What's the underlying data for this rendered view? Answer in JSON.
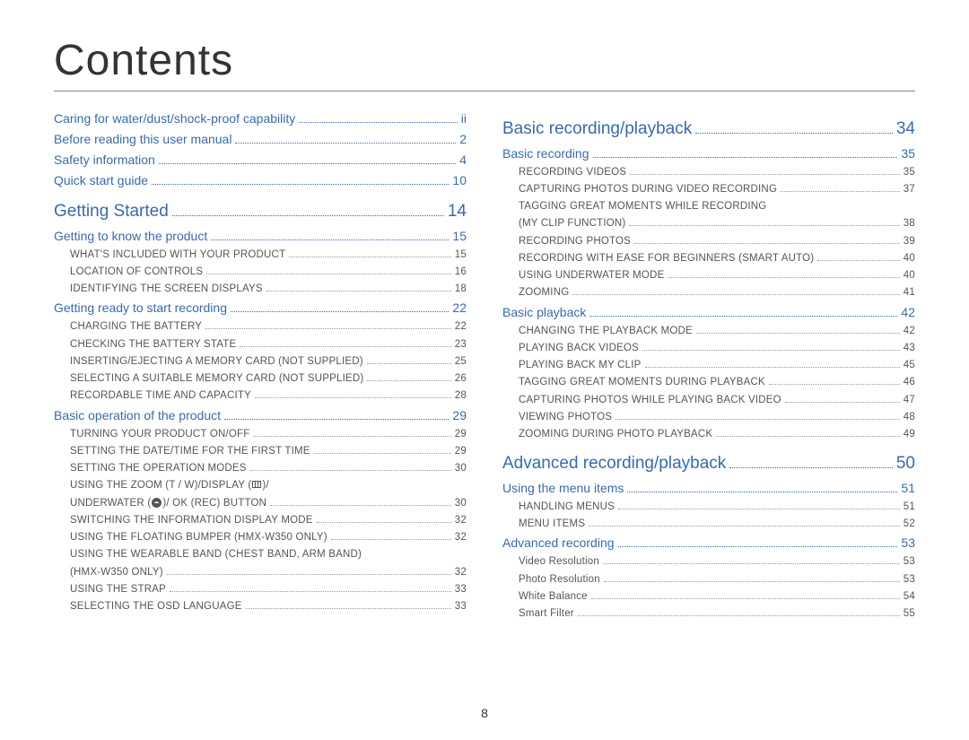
{
  "title": "Contents",
  "page_number": "8",
  "left": [
    {
      "level": "chapter",
      "label": "Caring for water/dust/shock-proof capability",
      "page": "ii"
    },
    {
      "level": "chapter",
      "label": "Before reading this user manual",
      "page": "2"
    },
    {
      "level": "chapter",
      "label": "Safety information",
      "page": "4"
    },
    {
      "level": "chapter",
      "label": "Quick start guide",
      "page": "10"
    },
    {
      "level": "section",
      "label": "Getting Started",
      "page": "14"
    },
    {
      "level": "chapter",
      "label": "Getting to know the product",
      "page": "15"
    },
    {
      "level": "sub",
      "label": "WHAT'S INCLUDED WITH YOUR PRODUCT",
      "page": "15"
    },
    {
      "level": "sub",
      "label": "LOCATION OF CONTROLS",
      "page": "16"
    },
    {
      "level": "sub",
      "label": "IDENTIFYING THE SCREEN DISPLAYS",
      "page": "18"
    },
    {
      "level": "chapter",
      "label": "Getting ready to start recording",
      "page": "22"
    },
    {
      "level": "sub",
      "label": "CHARGING THE BATTERY",
      "page": "22"
    },
    {
      "level": "sub",
      "label": "CHECKING THE BATTERY STATE",
      "page": "23"
    },
    {
      "level": "sub",
      "label": "INSERTING/EJECTING A MEMORY CARD (NOT SUPPLIED)",
      "page": "25"
    },
    {
      "level": "sub",
      "label": "SELECTING A SUITABLE MEMORY CARD (NOT SUPPLIED)",
      "page": "26"
    },
    {
      "level": "sub",
      "label": "RECORDABLE TIME AND CAPACITY",
      "page": "28"
    },
    {
      "level": "chapter",
      "label": "Basic operation of the product",
      "page": "29"
    },
    {
      "level": "sub",
      "label": "TURNING YOUR PRODUCT ON/OFF",
      "page": "29"
    },
    {
      "level": "sub",
      "label": "SETTING THE DATE/TIME FOR THE FIRST TIME",
      "page": "29"
    },
    {
      "level": "sub",
      "label": "SETTING THE OPERATION MODES",
      "page": "30"
    },
    {
      "level": "sub",
      "label": "USING THE ZOOM (T / W)/DISPLAY ([ICON_BOX])/",
      "page": "",
      "nopage": true
    },
    {
      "level": "sub",
      "label": "UNDERWATER ([ICON_UW])/ OK (REC) BUTTON",
      "page": "30"
    },
    {
      "level": "sub",
      "label": "SWITCHING THE INFORMATION DISPLAY MODE",
      "page": "32"
    },
    {
      "level": "sub",
      "label": "USING THE FLOATING BUMPER (HMX-W350 ONLY)",
      "page": "32"
    },
    {
      "level": "sub",
      "label": "USING THE WEARABLE BAND (CHEST BAND, ARM BAND)",
      "page": "",
      "nopage": true
    },
    {
      "level": "sub",
      "label": "(HMX-W350 ONLY)",
      "page": "32"
    },
    {
      "level": "sub",
      "label": "USING THE STRAP",
      "page": "33"
    },
    {
      "level": "sub",
      "label": "SELECTING THE OSD LANGUAGE",
      "page": "33"
    }
  ],
  "right": [
    {
      "level": "section",
      "label": "Basic recording/playback",
      "page": "34"
    },
    {
      "level": "chapter",
      "label": "Basic recording",
      "page": "35"
    },
    {
      "level": "sub",
      "label": "RECORDING VIDEOS",
      "page": "35"
    },
    {
      "level": "sub",
      "label": "CAPTURING PHOTOS DURING VIDEO RECORDING",
      "page": "37"
    },
    {
      "level": "sub",
      "label": "TAGGING GREAT MOMENTS WHILE RECORDING",
      "page": "",
      "nopage": true
    },
    {
      "level": "sub",
      "label": "(MY CLIP FUNCTION)",
      "page": "38"
    },
    {
      "level": "sub",
      "label": "RECORDING PHOTOS",
      "page": "39"
    },
    {
      "level": "sub",
      "label": "RECORDING WITH EASE FOR BEGINNERS (SMART AUTO)",
      "page": "40"
    },
    {
      "level": "sub",
      "label": "USING UNDERWATER MODE",
      "page": "40"
    },
    {
      "level": "sub",
      "label": "ZOOMING",
      "page": "41"
    },
    {
      "level": "chapter",
      "label": "Basic playback",
      "page": "42"
    },
    {
      "level": "sub",
      "label": "CHANGING THE PLAYBACK MODE",
      "page": "42"
    },
    {
      "level": "sub",
      "label": "PLAYING BACK VIDEOS",
      "page": "43"
    },
    {
      "level": "sub",
      "label": "PLAYING BACK MY CLIP",
      "page": "45"
    },
    {
      "level": "sub",
      "label": "TAGGING GREAT MOMENTS DURING PLAYBACK",
      "page": "46"
    },
    {
      "level": "sub",
      "label": "CAPTURING PHOTOS WHILE PLAYING BACK VIDEO",
      "page": "47"
    },
    {
      "level": "sub",
      "label": "VIEWING PHOTOS",
      "page": "48"
    },
    {
      "level": "sub",
      "label": "ZOOMING DURING PHOTO PLAYBACK",
      "page": "49"
    },
    {
      "level": "section",
      "label": "Advanced recording/playback",
      "page": "50"
    },
    {
      "level": "chapter",
      "label": "Using the menu items",
      "page": "51"
    },
    {
      "level": "sub",
      "label": "HANDLING MENUS",
      "page": "51"
    },
    {
      "level": "sub",
      "label": "MENU ITEMS",
      "page": "52"
    },
    {
      "level": "chapter",
      "label": "Advanced recording",
      "page": "53"
    },
    {
      "level": "sub",
      "label": "Video Resolution",
      "page": "53",
      "noupper": true
    },
    {
      "level": "sub",
      "label": "Photo Resolution",
      "page": "53",
      "noupper": true
    },
    {
      "level": "sub",
      "label": "White Balance",
      "page": "54",
      "noupper": true
    },
    {
      "level": "sub",
      "label": "Smart Filter",
      "page": "55",
      "noupper": true
    }
  ]
}
